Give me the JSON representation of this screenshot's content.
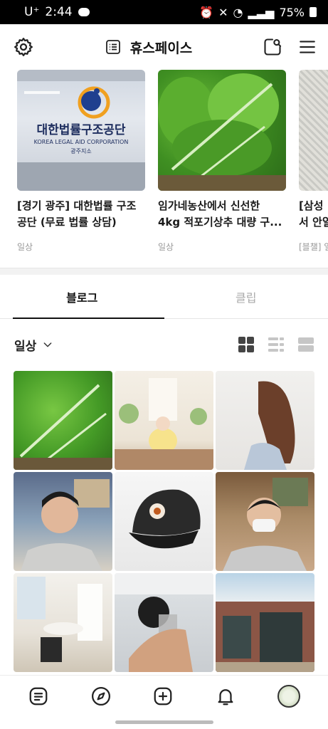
{
  "status_bar": {
    "carrier": "U⁺",
    "time": "2:44",
    "battery": "75%"
  },
  "header": {
    "title": "휴스페이스"
  },
  "featured": {
    "cards": [
      {
        "title": "[경기 광주] 대한법률 구조\n공단 (무료 법률 상담)",
        "category": "일상",
        "sign_ko": "대한법률구조공단",
        "sign_en": "KOREA LEGAL AID CORPORATION",
        "sign_branch": "광주지소"
      },
      {
        "title": "임가네농산에서 신선한\n4kg 적포기상추 대량 구...",
        "category": "일상"
      },
      {
        "title": "[삼성 ...\n서 안일...",
        "category": "[블챌] 일..."
      }
    ]
  },
  "tabs": [
    {
      "label": "블로그",
      "active": true
    },
    {
      "label": "클립",
      "active": false
    }
  ],
  "filter": {
    "label": "일상"
  },
  "nav": [
    "feed-icon",
    "compass-icon",
    "plus-square-icon",
    "bell-icon",
    "profile-avatar"
  ],
  "colors": {
    "active_tab": "#111111",
    "inactive_tab": "#aaaaaa",
    "status_bar_bg": "#000000"
  }
}
